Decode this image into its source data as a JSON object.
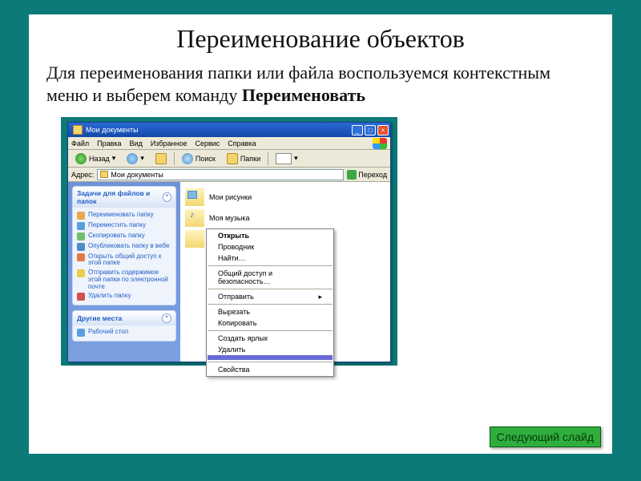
{
  "slide": {
    "title": "Переименование объектов",
    "body_plain": "Для переименования папки или файла воспользуемся контекстным меню и выберем команду ",
    "body_bold": "Переименовать",
    "next_button": "Следующий слайд"
  },
  "explorer": {
    "title": "Мои документы",
    "menu": [
      "Файл",
      "Правка",
      "Вид",
      "Избранное",
      "Сервис",
      "Справка"
    ],
    "toolbar": {
      "back": "Назад",
      "search": "Поиск",
      "folders": "Папки"
    },
    "address": {
      "label": "Адрес:",
      "value": "Мои документы",
      "go": "Переход"
    },
    "task_panel": {
      "header": "Задачи для файлов и папок",
      "items": [
        {
          "icon": "i-ren",
          "label": "Переименовать папку"
        },
        {
          "icon": "i-move",
          "label": "Переместить папку"
        },
        {
          "icon": "i-copy",
          "label": "Скопировать папку"
        },
        {
          "icon": "i-web",
          "label": "Опубликовать папку в вебе"
        },
        {
          "icon": "i-share",
          "label": "Открыть общий доступ к этой папке"
        },
        {
          "icon": "i-mail",
          "label": "Отправить содержимое этой папки по электронной почте"
        },
        {
          "icon": "i-del",
          "label": "Удалить папку"
        }
      ]
    },
    "places_panel": {
      "header": "Другие места",
      "items": [
        {
          "icon": "i-desk",
          "label": "Рабочий стол"
        }
      ]
    },
    "files": [
      {
        "label": "Мои рисунки",
        "kind": "pics"
      },
      {
        "label": "Моя музыка",
        "kind": "mus"
      },
      {
        "label": "",
        "kind": "sel"
      }
    ],
    "context_menu": [
      {
        "type": "item",
        "label": "Открыть",
        "bold": true
      },
      {
        "type": "item",
        "label": "Проводник"
      },
      {
        "type": "item",
        "label": "Найти…"
      },
      {
        "type": "sep"
      },
      {
        "type": "item",
        "label": "Общий доступ и безопасность…"
      },
      {
        "type": "sep"
      },
      {
        "type": "item",
        "label": "Отправить",
        "arrow": true
      },
      {
        "type": "sep"
      },
      {
        "type": "item",
        "label": "Вырезать"
      },
      {
        "type": "item",
        "label": "Копировать"
      },
      {
        "type": "sep"
      },
      {
        "type": "item",
        "label": "Создать ярлык"
      },
      {
        "type": "item",
        "label": "Удалить"
      },
      {
        "type": "highlight",
        "label": " "
      },
      {
        "type": "sep"
      },
      {
        "type": "item",
        "label": "Свойства"
      }
    ]
  }
}
